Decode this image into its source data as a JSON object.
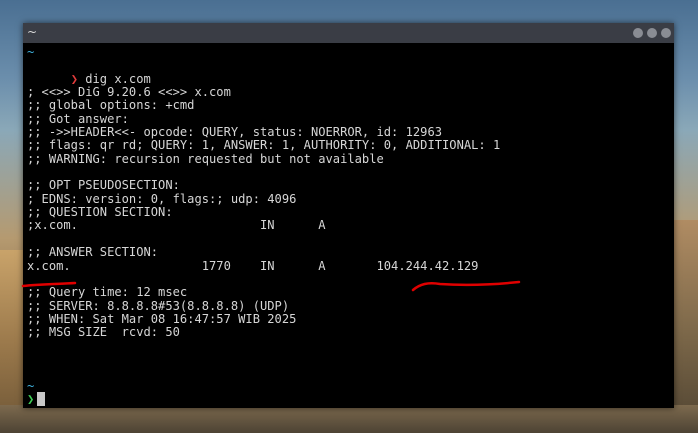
{
  "window": {
    "title": "~"
  },
  "terminal": {
    "lines": [
      "~",
      "❯",
      "dig x.com",
      "",
      "; <<>> DiG 9.20.6 <<>> x.com",
      ";; global options: +cmd",
      ";; Got answer:",
      ";; ->>HEADER<<- opcode: QUERY, status: NOERROR, id: 12963",
      ";; flags: qr rd; QUERY: 1, ANSWER: 1, AUTHORITY: 0, ADDITIONAL: 1",
      ";; WARNING: recursion requested but not available",
      "",
      ";; OPT PSEUDOSECTION:",
      "; EDNS: version: 0, flags:; udp: 4096",
      ";; QUESTION SECTION:",
      ";x.com.                         IN      A",
      "",
      ";; ANSWER SECTION:",
      "x.com.                  1770    IN      A       104.244.42.129",
      "",
      ";; Query time: 12 msec",
      ";; SERVER: 8.8.8.8#53(8.8.8.8) (UDP)",
      ";; WHEN: Sat Mar 08 16:47:57 WIB 2025",
      ";; MSG SIZE  rcvd: 50",
      "",
      "",
      "~",
      "❯"
    ]
  },
  "colors": {
    "tilde": "#3fb3e0",
    "prompt_error": "#e23b3b",
    "prompt_ok": "#3fce57",
    "annotation": "#e00000"
  }
}
